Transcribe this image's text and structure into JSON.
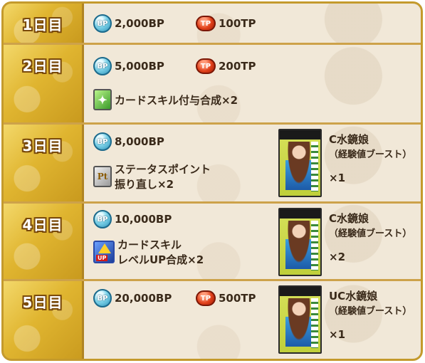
{
  "days": [
    {
      "label": "1日目",
      "bp": "2,000BP",
      "tp": "100TP"
    },
    {
      "label": "2日目",
      "bp": "5,000BP",
      "tp": "200TP",
      "skill": "カードスキル付与合成×2"
    },
    {
      "label": "3日目",
      "bp": "8,000BP",
      "status_line1": "ステータスポイント",
      "status_line2": "振り直し×2",
      "card_name": "C水鏡娘",
      "card_sub": "（経験値ブースト）",
      "card_qty": "×1"
    },
    {
      "label": "4日目",
      "bp": "10,000BP",
      "skill_line1": "カードスキル",
      "skill_line2": "レベルUP合成×2",
      "card_name": "C水鏡娘",
      "card_sub": "（経験値ブースト）",
      "card_qty": "×2"
    },
    {
      "label": "5日目",
      "bp": "20,000BP",
      "tp": "500TP",
      "card_name": "UC水鏡娘",
      "card_sub": "（経験値ブースト）",
      "card_qty": "×1"
    }
  ],
  "icons": {
    "bp": "BP",
    "tp": "TP",
    "pt": "Pt",
    "up": "UP"
  },
  "colors": {
    "gold": "#e0b530",
    "frame": "#c49a2c",
    "content_bg": "#f1e8d8",
    "text": "#3a2a1a"
  }
}
